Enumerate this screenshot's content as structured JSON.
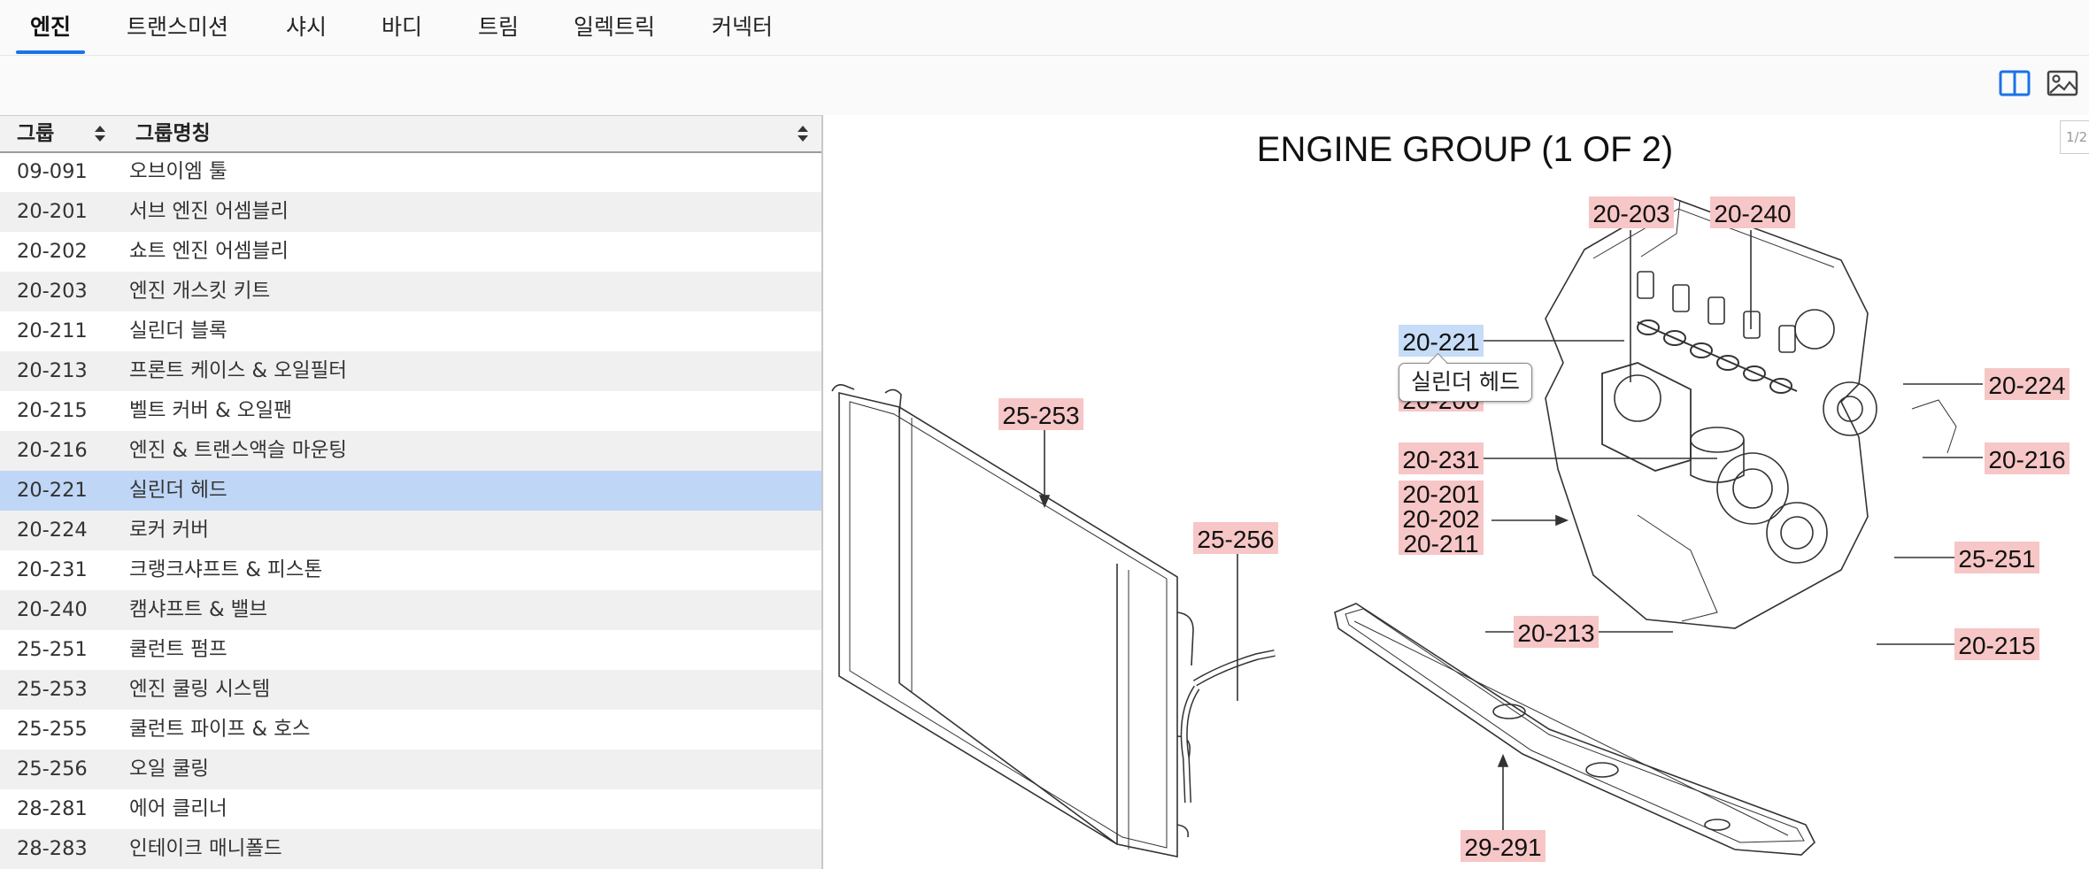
{
  "tabs": [
    {
      "label": "엔진",
      "active": true
    },
    {
      "label": "트랜스미션",
      "active": false
    },
    {
      "label": "샤시",
      "active": false
    },
    {
      "label": "바디",
      "active": false
    },
    {
      "label": "트림",
      "active": false
    },
    {
      "label": "일렉트릭",
      "active": false
    },
    {
      "label": "커넥터",
      "active": false
    }
  ],
  "toolbar": {
    "icons": [
      "split-view-icon",
      "image-view-icon"
    ],
    "accent": "#1a73e8"
  },
  "table": {
    "headers": {
      "group": "그룹",
      "group_name": "그룹명칭"
    },
    "selected_code": "20-221",
    "rows": [
      {
        "code": "09-091",
        "name": "오브이엠 툴"
      },
      {
        "code": "20-201",
        "name": "서브 엔진 어셈블리"
      },
      {
        "code": "20-202",
        "name": "쇼트 엔진 어셈블리"
      },
      {
        "code": "20-203",
        "name": "엔진 개스킷 키트"
      },
      {
        "code": "20-211",
        "name": "실린더 블록"
      },
      {
        "code": "20-213",
        "name": "프론트 케이스 & 오일필터"
      },
      {
        "code": "20-215",
        "name": "벨트 커버 & 오일팬"
      },
      {
        "code": "20-216",
        "name": "엔진 & 트랜스액슬 마운팅"
      },
      {
        "code": "20-221",
        "name": "실린더 헤드"
      },
      {
        "code": "20-224",
        "name": "로커 커버"
      },
      {
        "code": "20-231",
        "name": "크랭크샤프트 & 피스톤"
      },
      {
        "code": "20-240",
        "name": "캠샤프트 & 밸브"
      },
      {
        "code": "25-251",
        "name": "쿨런트 펌프"
      },
      {
        "code": "25-253",
        "name": "엔진 쿨링 시스템"
      },
      {
        "code": "25-255",
        "name": "쿨런트 파이프 & 호스"
      },
      {
        "code": "25-256",
        "name": "오일 쿨링"
      },
      {
        "code": "28-281",
        "name": "에어 클리너"
      },
      {
        "code": "28-283",
        "name": "인테이크 매니폴드"
      }
    ]
  },
  "diagram": {
    "title": "ENGINE GROUP (1 OF 2)",
    "page_badge": "1/2",
    "tooltip": "실린더 헤드",
    "callouts": {
      "c_20_203": "20-203",
      "c_20_240": "20-240",
      "c_20_221": "20-221",
      "c_20_200": "20-200",
      "c_20_224": "20-224",
      "c_25_253": "25-253",
      "c_20_231": "20-231",
      "c_20_216": "20-216",
      "c_20_201": "20-201",
      "c_20_202": "20-202",
      "c_20_211": "20-211",
      "c_25_256": "25-256",
      "c_25_251": "25-251",
      "c_20_213": "20-213",
      "c_20_215": "20-215",
      "c_29_291": "29-291"
    },
    "callout_color": "#f7c6c6",
    "highlight_color": "#c6dcf7"
  }
}
